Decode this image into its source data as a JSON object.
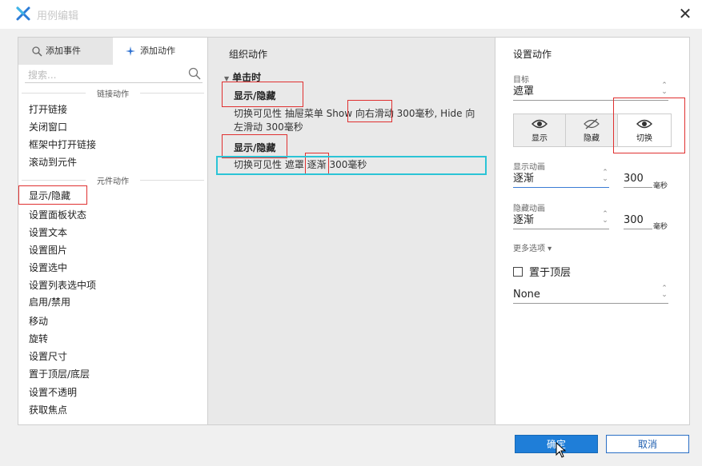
{
  "window": {
    "title": "用例编辑"
  },
  "left": {
    "tabs": {
      "add_event": "添加事件",
      "add_action": "添加动作"
    },
    "search_placeholder": "搜索...",
    "section_link": "链接动作",
    "link_items": [
      "打开链接",
      "关闭窗口",
      "框架中打开链接",
      "滚动到元件"
    ],
    "section_widget": "元件动作",
    "widget_items": [
      "显示/隐藏",
      "设置面板状态",
      "设置文本",
      "设置图片",
      "设置选中",
      "设置列表选中项",
      "启用/禁用",
      "移动",
      "旋转",
      "设置尺寸",
      "置于顶层/底层",
      "设置不透明",
      "获取焦点"
    ]
  },
  "middle": {
    "header": "组织动作",
    "event": "单击时",
    "actions": [
      {
        "name": "显示/隐藏",
        "desc": "切换可见性 抽屉菜单 Show 向右滑动 300毫秒, Hide 向左滑动 300毫秒"
      },
      {
        "name": "显示/隐藏",
        "desc": "切换可见性 遮罩 逐渐 300毫秒"
      }
    ]
  },
  "right": {
    "header": "设置动作",
    "target_label": "目标",
    "target_value": "遮罩",
    "visibility": {
      "show": "显示",
      "hide": "隐藏",
      "toggle": "切换"
    },
    "show_anim_label": "显示动画",
    "show_anim_value": "逐渐",
    "show_duration": "300",
    "hide_anim_label": "隐藏动画",
    "hide_anim_value": "逐渐",
    "hide_duration": "300",
    "unit": "毫秒",
    "more_options": "更多选项 ▾",
    "bring_front": "置于顶层",
    "none_option": "None"
  },
  "buttons": {
    "ok": "确定",
    "cancel": "取消"
  },
  "colors": {
    "accent": "#1f7ed8",
    "annotation_red": "#e03030",
    "annotation_cyan": "#2bc4d6"
  }
}
